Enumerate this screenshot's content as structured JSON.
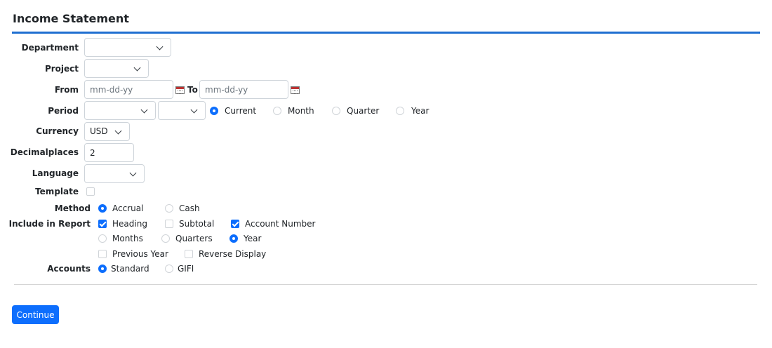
{
  "page": {
    "title": "Income Statement"
  },
  "department": {
    "label": "Department",
    "value": ""
  },
  "project": {
    "label": "Project",
    "value": ""
  },
  "from": {
    "label": "From",
    "placeholder": "mm-dd-yy"
  },
  "to": {
    "label": "To",
    "placeholder": "mm-dd-yy"
  },
  "period": {
    "label": "Period",
    "select1_value": "",
    "select2_value": "",
    "options": [
      "Current",
      "Month",
      "Quarter",
      "Year"
    ],
    "selected": "Current"
  },
  "currency": {
    "label": "Currency",
    "value": "USD"
  },
  "decimalplaces": {
    "label": "Decimalplaces",
    "value": "2"
  },
  "language": {
    "label": "Language",
    "value": ""
  },
  "template": {
    "label": "Template",
    "checked": false
  },
  "method": {
    "label": "Method",
    "options": [
      "Accrual",
      "Cash"
    ],
    "selected": "Accrual"
  },
  "include": {
    "label": "Include in Report",
    "heading": "Heading",
    "heading_checked": true,
    "subtotal": "Subtotal",
    "subtotal_checked": false,
    "account_number": "Account Number",
    "account_number_checked": true,
    "months": "Months",
    "quarters": "Quarters",
    "year": "Year",
    "range_selected": "Year",
    "previous_year": "Previous Year",
    "previous_year_checked": false,
    "reverse_display": "Reverse Display",
    "reverse_display_checked": false
  },
  "accounts": {
    "label": "Accounts",
    "options": [
      "Standard",
      "GIFI"
    ],
    "selected": "Standard"
  },
  "actions": {
    "continue_label": "Continue"
  }
}
